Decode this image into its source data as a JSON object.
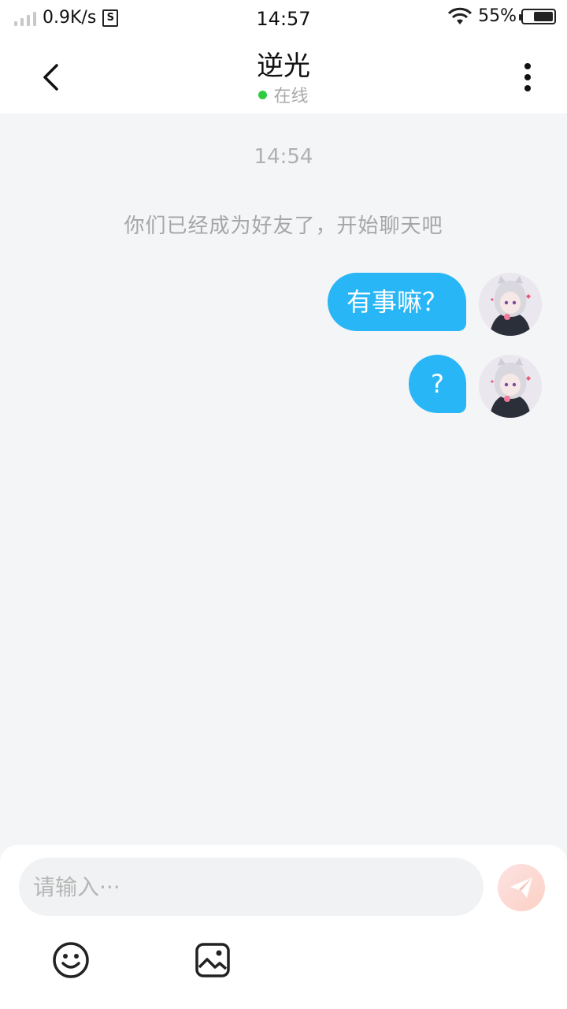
{
  "status_bar": {
    "net_speed": "0.9K/s",
    "s_badge": "S",
    "time": "14:57",
    "battery_pct": "55%"
  },
  "header": {
    "title": "逆光",
    "presence": "在线",
    "presence_color": "#2ecc40"
  },
  "chat": {
    "time_label": "14:54",
    "system_message": "你们已经成为好友了，开始聊天吧",
    "messages": [
      {
        "text": "有事嘛？",
        "side": "right"
      },
      {
        "text": "?",
        "side": "right"
      }
    ],
    "bubble_color": "#29b6f6"
  },
  "composer": {
    "placeholder": "请输入···",
    "icons": [
      "emoji-icon",
      "image-icon",
      "send-icon"
    ]
  }
}
